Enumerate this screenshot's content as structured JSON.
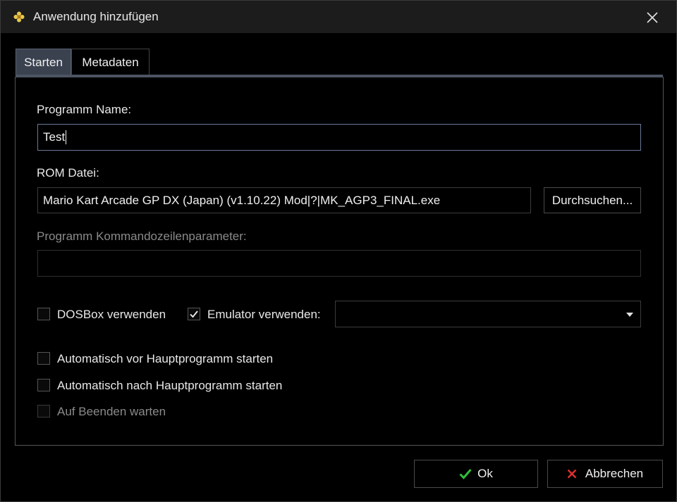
{
  "window": {
    "title": "Anwendung hinzufügen"
  },
  "tabs": [
    {
      "label": "Starten",
      "active": true
    },
    {
      "label": "Metadaten",
      "active": false
    }
  ],
  "form": {
    "program_name_label": "Programm Name:",
    "program_name_value": "Test",
    "rom_file_label": "ROM Datei:",
    "rom_file_value": "Mario Kart Arcade GP DX (Japan) (v1.10.22) Mod|?|MK_AGP3_FINAL.exe",
    "browse_label": "Durchsuchen...",
    "cmdline_label": "Programm Kommandozeilenparameter:",
    "cmdline_value": "",
    "dosbox_label": "DOSBox verwenden",
    "dosbox_checked": false,
    "emulator_label": "Emulator verwenden:",
    "emulator_checked": true,
    "emulator_selected": "",
    "auto_before_label": "Automatisch vor Hauptprogramm starten",
    "auto_before_checked": false,
    "auto_after_label": "Automatisch nach Hauptprogramm starten",
    "auto_after_checked": false,
    "wait_exit_label": "Auf Beenden warten",
    "wait_exit_checked": false
  },
  "footer": {
    "ok_label": "Ok",
    "cancel_label": "Abbrechen"
  },
  "colors": {
    "ok_icon": "#2fbf3a",
    "cancel_icon": "#e03030",
    "app_icon": "#e8c84a"
  }
}
